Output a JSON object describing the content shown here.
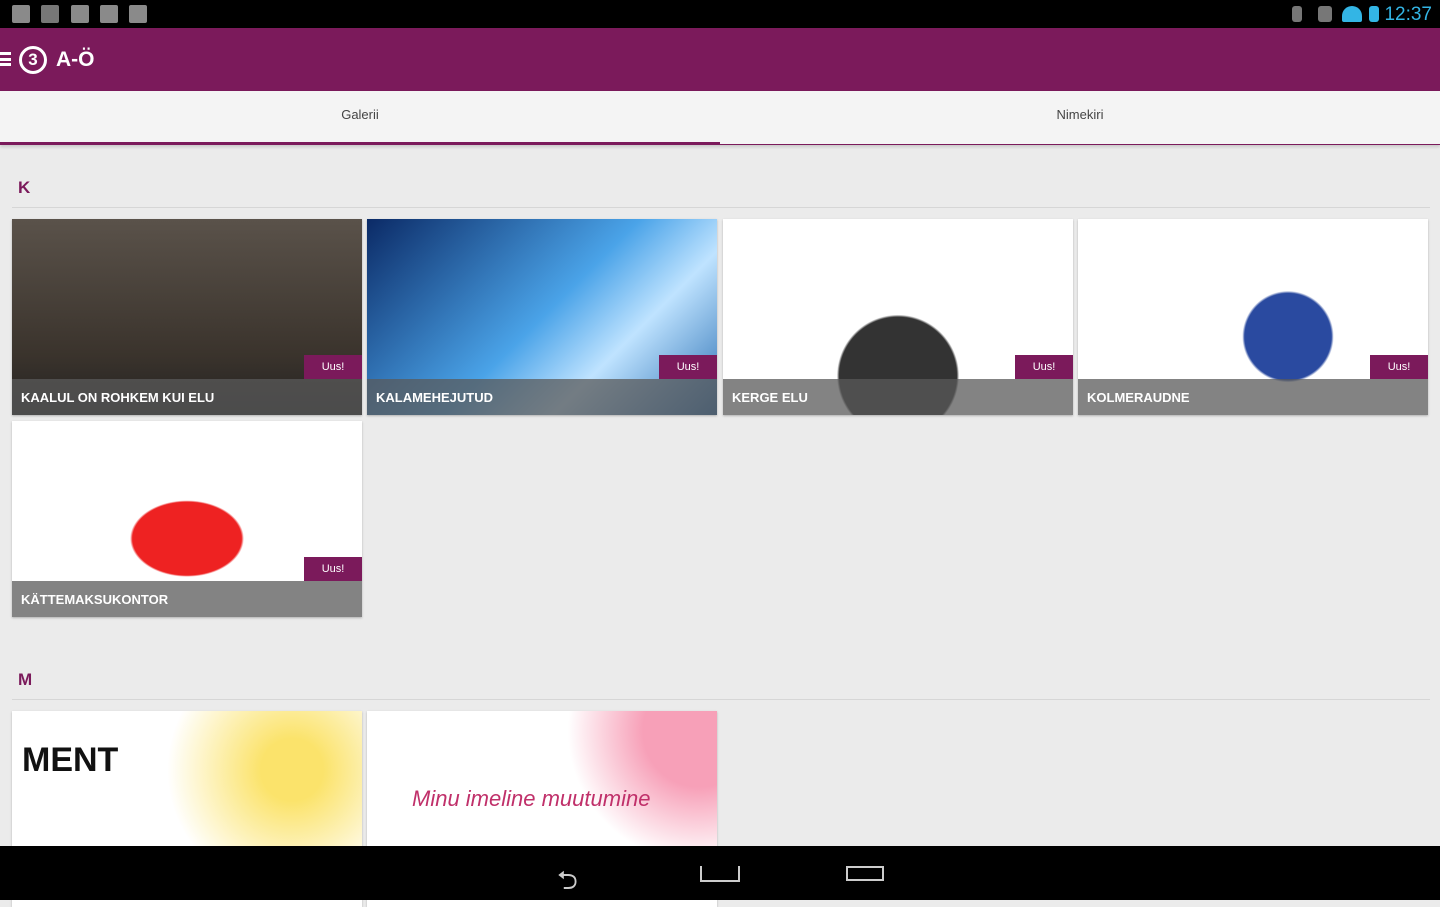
{
  "status": {
    "time": "12:37"
  },
  "appbar": {
    "logo": "3",
    "title": "A-Ö"
  },
  "tabs": [
    {
      "label": "Galerii"
    },
    {
      "label": "Nimekiri"
    }
  ],
  "sections": [
    {
      "letter": "K",
      "items": [
        {
          "title": "KAALUL ON ROHKEM KUI ELU",
          "badge": "Uus!"
        },
        {
          "title": "KALAMEHEJUTUD",
          "badge": "Uus!"
        },
        {
          "title": "KERGE ELU",
          "badge": "Uus!"
        },
        {
          "title": "KOLMERAUDNE",
          "badge": "Uus!"
        },
        {
          "title": "KÄTTEMAKSUKONTOR",
          "badge": "Uus!"
        }
      ]
    },
    {
      "letter": "M",
      "items": [
        {
          "title": "MENT"
        },
        {
          "title": "Minu imeline muutumine"
        }
      ]
    }
  ],
  "nav": {
    "back": "back-icon",
    "home": "home-icon",
    "recents": "recents-icon"
  }
}
